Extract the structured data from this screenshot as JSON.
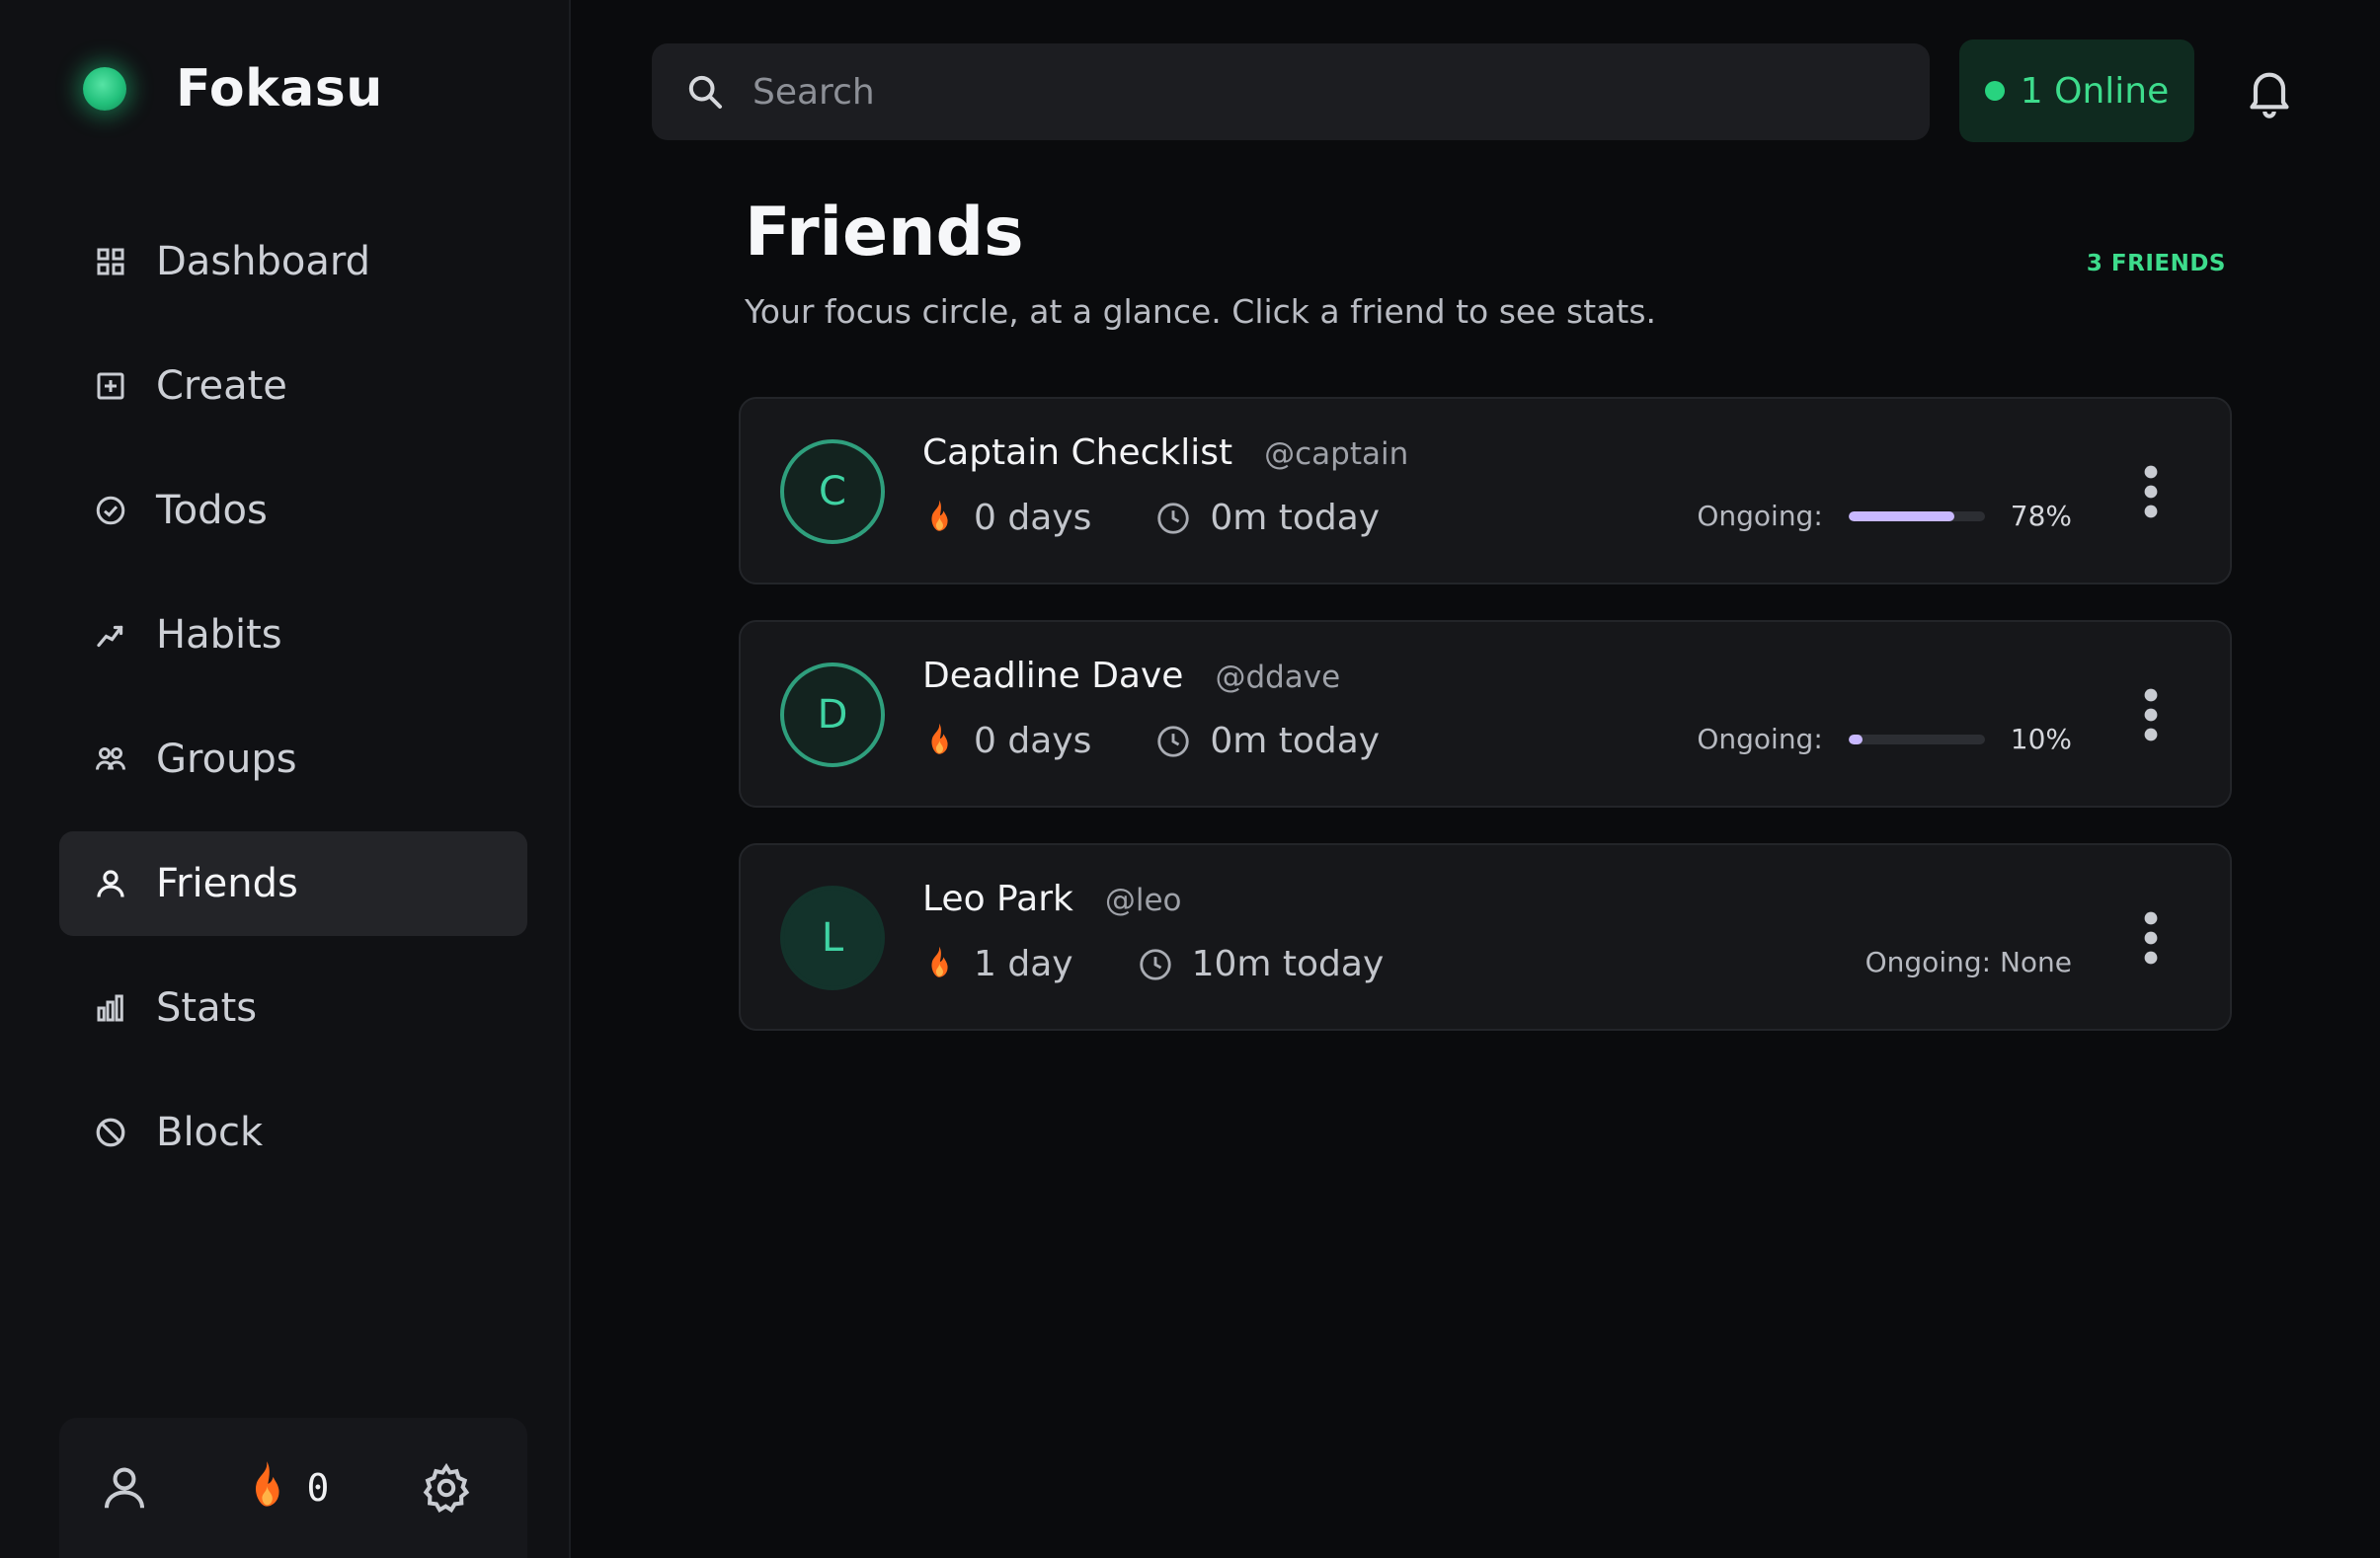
{
  "app": {
    "name": "Fokasu"
  },
  "sidebar": {
    "items": [
      {
        "label": "Dashboard",
        "icon": "grid-icon"
      },
      {
        "label": "Create",
        "icon": "plus-square-icon"
      },
      {
        "label": "Todos",
        "icon": "check-circle-icon"
      },
      {
        "label": "Habits",
        "icon": "trend-icon"
      },
      {
        "label": "Groups",
        "icon": "group-icon"
      },
      {
        "label": "Friends",
        "icon": "user-icon",
        "active": true
      },
      {
        "label": "Stats",
        "icon": "bar-chart-icon"
      },
      {
        "label": "Block",
        "icon": "block-icon"
      }
    ],
    "footer": {
      "streak_count": "0"
    }
  },
  "topbar": {
    "search_placeholder": "Search",
    "online_label": "1 Online"
  },
  "page": {
    "title": "Friends",
    "subtitle": "Your focus circle, at a glance. Click a friend to see stats.",
    "count_label": "3 FRIENDS"
  },
  "friends": [
    {
      "initial": "C",
      "name": "Captain Checklist",
      "handle": "@captain",
      "streak": "0 days",
      "today": "0m today",
      "ongoing_label": "Ongoing:",
      "ongoing_pct": "78%",
      "ongoing_value": 78
    },
    {
      "initial": "D",
      "name": "Deadline Dave",
      "handle": "@ddave",
      "streak": "0 days",
      "today": "0m today",
      "ongoing_label": "Ongoing:",
      "ongoing_pct": "10%",
      "ongoing_value": 10
    },
    {
      "initial": "L",
      "name": "Leo Park",
      "handle": "@leo",
      "streak": "1 day",
      "today": "10m today",
      "ongoing_label": "Ongoing: None"
    }
  ],
  "colors": {
    "accent_green": "#3ddc8c",
    "progress_fill": "#c8b8ff",
    "flame": "#ff6a1a"
  }
}
